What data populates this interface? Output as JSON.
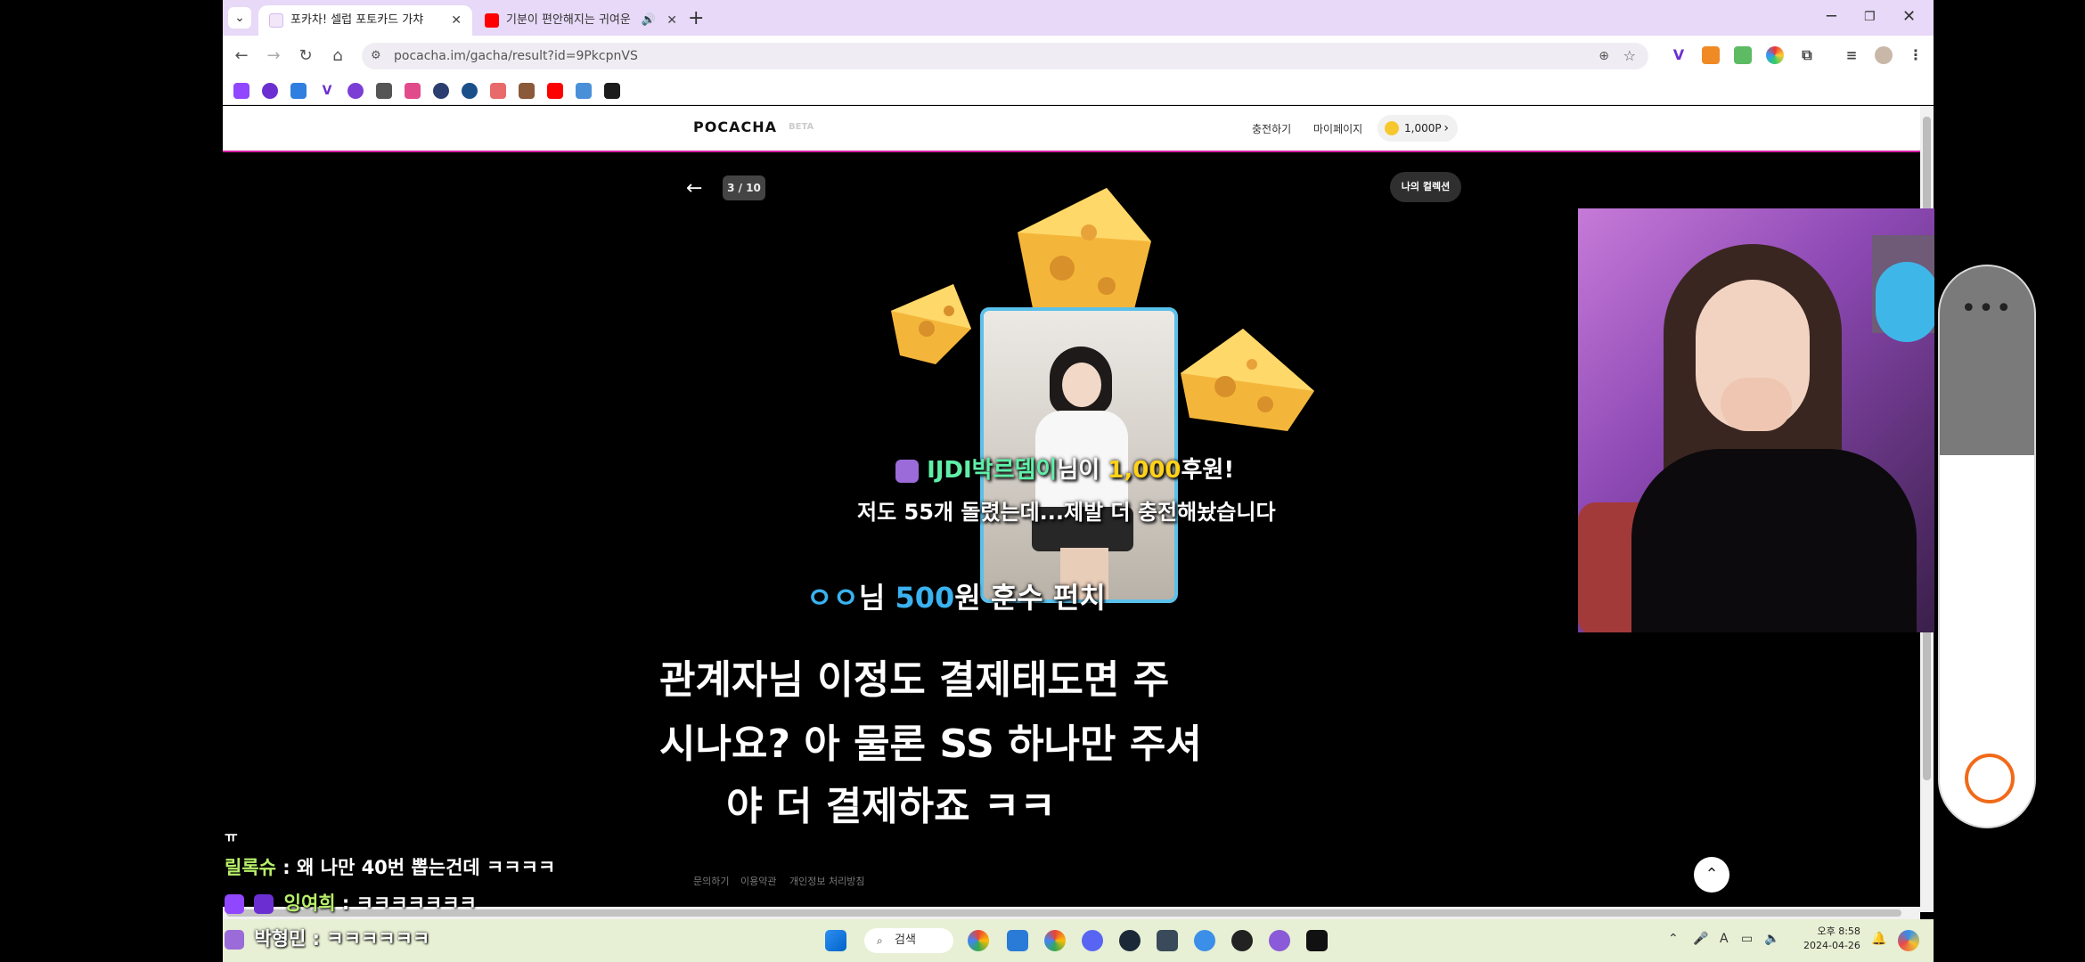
{
  "browser": {
    "tabs": [
      {
        "label": "포카차! 셀럽 포토카드 가챠",
        "active": true
      },
      {
        "label": "기분이 편안해지는 귀여운",
        "active": false
      }
    ],
    "url": "pocacha.im/gacha/result?id=9PkcpnVS",
    "window_controls": {
      "minimize": "─",
      "restore": "❐",
      "close": "✕"
    },
    "new_tab": "+"
  },
  "site": {
    "logo": "POCACHA",
    "beta": "BETA",
    "nav": {
      "charge": "충전하기",
      "mypage": "마이페이지"
    },
    "points": "1,000P",
    "counter": "3 / 10",
    "collection_button": "나의 컬렉션",
    "footer": [
      "문의하기",
      "이용약관",
      "개인정보 처리방침"
    ]
  },
  "overlay": {
    "donor_name": "IJDI박르뎀이",
    "donor_suffix": "님이",
    "donor_amount": "1,000",
    "donor_tail": "후원!",
    "donor_message": "저도 55개 돌렸는데...제발 더 충전해놨습니다",
    "cheer_name": "ㅇㅇ",
    "cheer_mid": "님",
    "cheer_amount": "500",
    "cheer_tail": "원 훈수 펀치",
    "big_lines": [
      "관계자님 이정도 결제태도면 주",
      "시나요? 아 물론 SS 하나만 주셔",
      "야 더 결제하죠 ㅋㅋ"
    ]
  },
  "chat": {
    "top_fragment": "ㅠ",
    "lines": [
      {
        "nick": "릴록슈",
        "text": " : 왜 나만 40번 뽑는건데 ㅋㅋㅋㅋ"
      },
      {
        "nick": "잉여희",
        "text": " : ㅋㅋㅋㅋㅋㅋㅋ"
      },
      {
        "nick": "박형민",
        "text": " : ㅋㅋㅋㅋㅋㅋ"
      }
    ]
  },
  "taskbar": {
    "search": "검색",
    "clock_time": "오후 8:58",
    "clock_date": "2024-04-26"
  },
  "colors": {
    "accent": "#d61fa5",
    "tabbar": "#e7d9f7",
    "taskbar": "#e7f0d4",
    "donor_name": "#5ff0a8",
    "donor_amount": "#ffd21a",
    "cheer": "#3ab2f0"
  }
}
